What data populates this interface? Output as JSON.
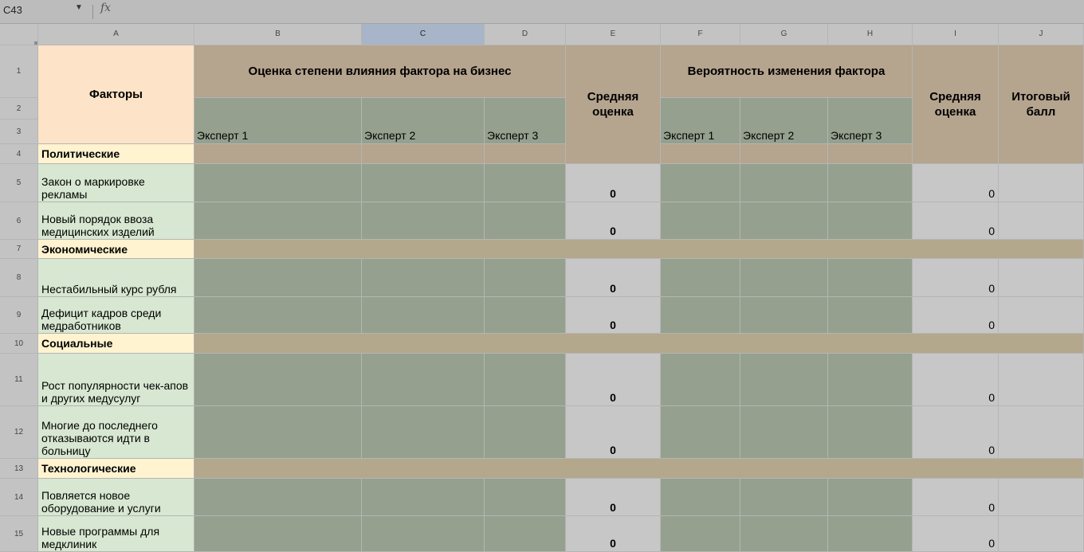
{
  "formula_bar": {
    "cell_ref": "C43",
    "fx_label": "fx"
  },
  "columns": [
    "A",
    "B",
    "C",
    "D",
    "E",
    "F",
    "G",
    "H",
    "I",
    "J"
  ],
  "rows": [
    "1",
    "2",
    "3",
    "4",
    "5",
    "6",
    "7",
    "8",
    "9",
    "10",
    "11",
    "12",
    "13",
    "14",
    "15"
  ],
  "headers": {
    "factors": "Факторы",
    "impact": "Оценка степени влияния фактора на бизнес",
    "probability": "Вероятность изменения фактора",
    "avg": "Средняя оценка",
    "total": "Итоговый балл",
    "expert1": "Эксперт 1",
    "expert2": "Эксперт 2",
    "expert3": "Эксперт 3"
  },
  "categories": {
    "political": "Политические",
    "economic": "Экономические",
    "social": "Социальные",
    "technological": "Технологические"
  },
  "factors": [
    "Закон о маркировке рекламы",
    "Новый порядок ввоза медицинских изделий",
    "Нестабильный курс рубля",
    "Дефицит кадров среди медработников",
    "Рост популярности чек-апов и других медусулуг",
    "Многие до последнего отказываются идти в больницу",
    "Повляется новое оборудование и услуги",
    "Новые программы для медклиник"
  ],
  "zero": "0"
}
